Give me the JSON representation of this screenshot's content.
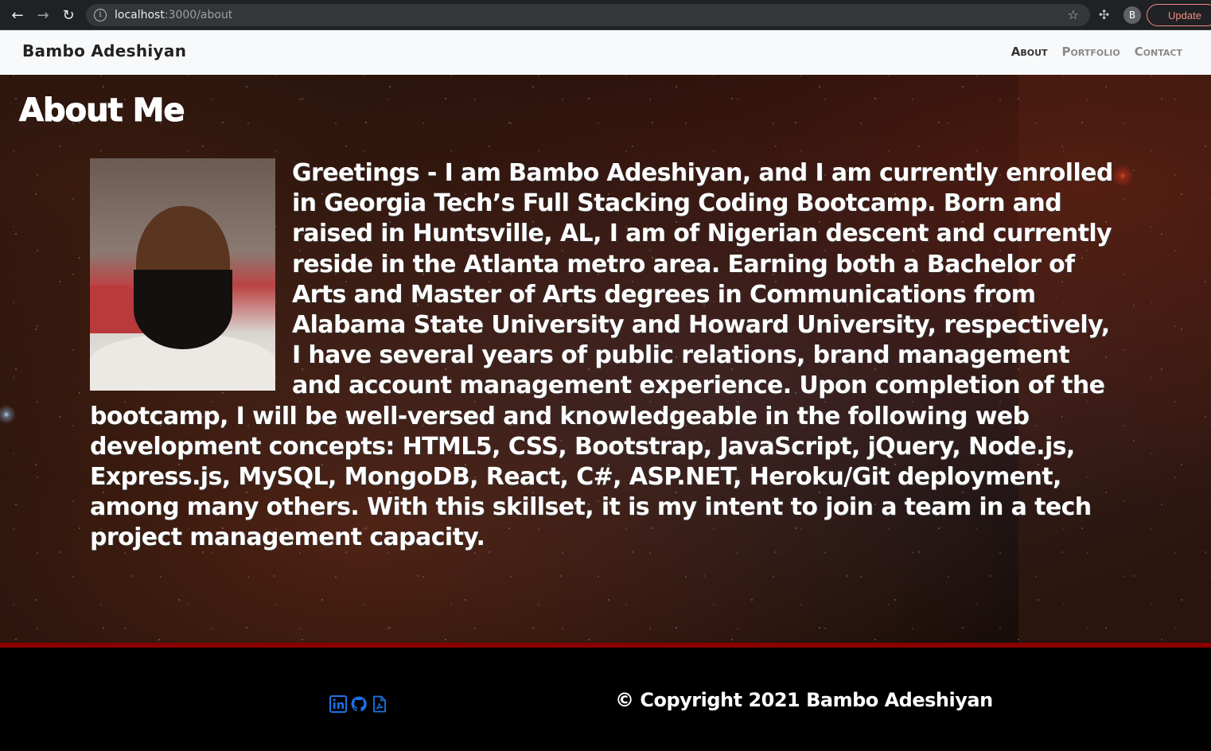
{
  "browser": {
    "url_host": "localhost",
    "url_path": ":3000/about",
    "profile_initial": "B",
    "update_label": "Update"
  },
  "navbar": {
    "brand": "Bambo Adeshiyan",
    "links": [
      {
        "label": "About",
        "active": true
      },
      {
        "label": "Portfolio",
        "active": false
      },
      {
        "label": "Contact",
        "active": false
      }
    ]
  },
  "main": {
    "title": "About Me",
    "bio": "Greetings - I am Bambo Adeshiyan, and I am currently enrolled in Georgia Tech’s Full Stacking Coding Bootcamp. Born and raised in Huntsville, AL, I am of Nigerian descent and currently reside in the Atlanta metro area. Earning both a Bachelor of Arts and Master of Arts degrees in Communications from Alabama State University and Howard University, respectively, I have several years of public relations, brand management and account management experience. Upon completion of the bootcamp, I will be well-versed and knowledgeable in the following web development concepts: HTML5, CSS, Bootstrap, JavaScript, jQuery, Node.js, Express.js, MySQL, MongoDB, React, C#, ASP.NET, Heroku/Git deployment, among many others. With this skillset, it is my intent to join a team in a tech project management capacity."
  },
  "footer": {
    "copyright": "© Copyright 2021 Bambo Adeshiyan",
    "social_icons": [
      "linkedin-icon",
      "github-icon",
      "pdf-resume-icon"
    ]
  },
  "colors": {
    "footer_rule": "#8b0000",
    "social_icon": "#1a73e8",
    "update_accent": "#f28b82"
  }
}
